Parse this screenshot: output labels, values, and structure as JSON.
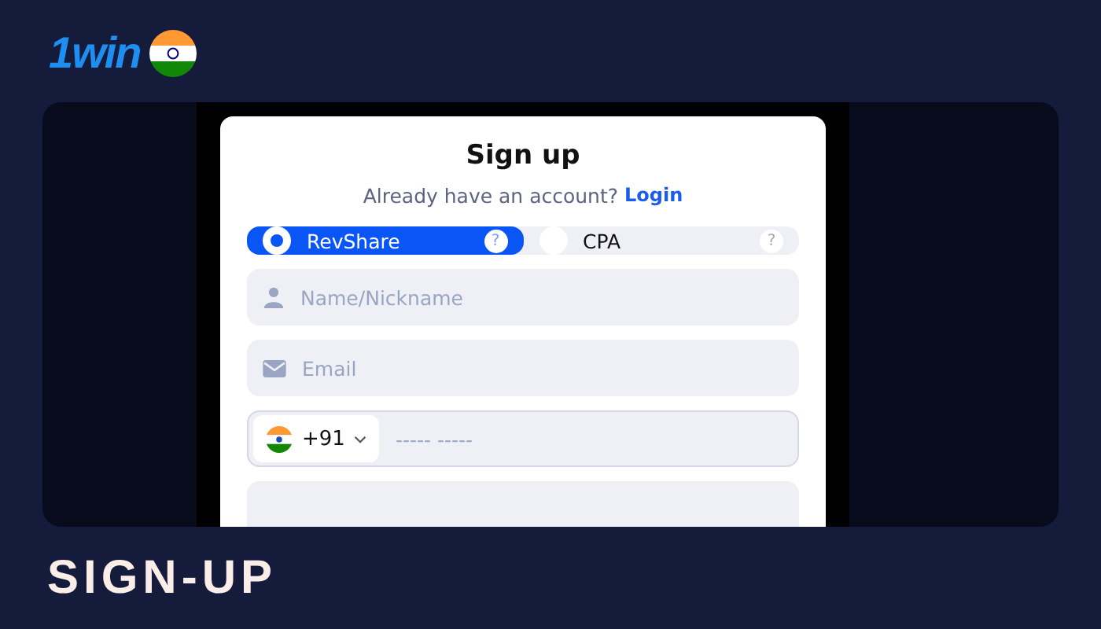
{
  "logo": {
    "text": "1win"
  },
  "form": {
    "title": "Sign up",
    "subtitle": "Already have an account?",
    "login_link": "Login",
    "plans": [
      {
        "label": "RevShare",
        "help": "?",
        "selected": true
      },
      {
        "label": "CPA",
        "help": "?",
        "selected": false
      }
    ],
    "fields": [
      {
        "kind": "name",
        "placeholder": "Name/Nickname"
      },
      {
        "kind": "email",
        "placeholder": "Email"
      },
      {
        "kind": "phone",
        "code": "+91",
        "placeholder": "----- -----"
      }
    ]
  },
  "caption": "SIGN-UP"
}
